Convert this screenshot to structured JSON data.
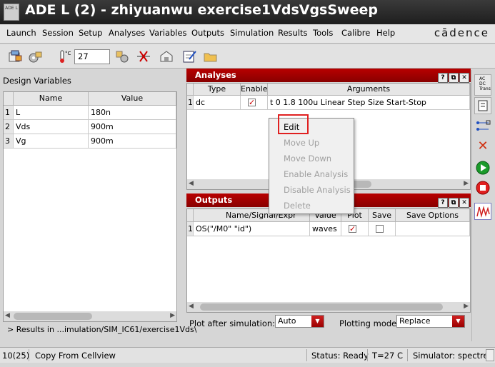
{
  "window": {
    "title": "ADE L (2) - zhiyuanwu exercise1VdsVgsSweep",
    "icon_text": "ADE L"
  },
  "menubar": {
    "items": [
      "Launch",
      "Session",
      "Setup",
      "Analyses",
      "Variables",
      "Outputs",
      "Simulation",
      "Results",
      "Tools",
      "Calibre",
      "Help"
    ],
    "brand": "cādence"
  },
  "toolbar": {
    "temperature": "27"
  },
  "design_variables": {
    "label": "Design Variables",
    "columns": [
      "Name",
      "Value"
    ],
    "rows": [
      {
        "num": "1",
        "name": "L",
        "value": "180n"
      },
      {
        "num": "2",
        "name": "Vds",
        "value": "900m"
      },
      {
        "num": "3",
        "name": "Vg",
        "value": "900m"
      }
    ],
    "results_path": "> Results in ...imulation/SIM_IC61/exercise1Vds\\"
  },
  "analyses": {
    "title": "Analyses",
    "columns": [
      "Type",
      "Enable",
      "Arguments"
    ],
    "rows": [
      {
        "num": "1",
        "type": "dc",
        "enabled": true,
        "arguments": "t 0 1.8 100u Linear Step Size Start-Stop"
      }
    ]
  },
  "context_menu": {
    "items": [
      "Edit",
      "Move Up",
      "Move Down",
      "Enable Analysis",
      "Disable Analysis",
      "Delete"
    ]
  },
  "outputs": {
    "title": "Outputs",
    "columns": [
      "Name/Signal/Expr",
      "Value",
      "Plot",
      "Save",
      "Save Options"
    ],
    "rows": [
      {
        "num": "1",
        "name": "OS(\"/M0\" \"id\")",
        "value": "waves",
        "plot": true,
        "save": false
      }
    ]
  },
  "plot_controls": {
    "plot_after_label": "Plot after simulation:",
    "plot_after_value": "Auto",
    "plotting_mode_label": "Plotting mode:",
    "plotting_mode_value": "Replace"
  },
  "right_toolbar": {
    "analysis_icon_labels": [
      "AC",
      "DC",
      "Trans"
    ]
  },
  "panel_buttons": [
    "?",
    "⧉",
    "✕"
  ],
  "statusbar": {
    "counter": "10(25)",
    "message": "Copy From Cellview",
    "status": "Status: Ready",
    "temperature": "T=27",
    "unit": "C",
    "simulator": "Simulator: spectre"
  }
}
